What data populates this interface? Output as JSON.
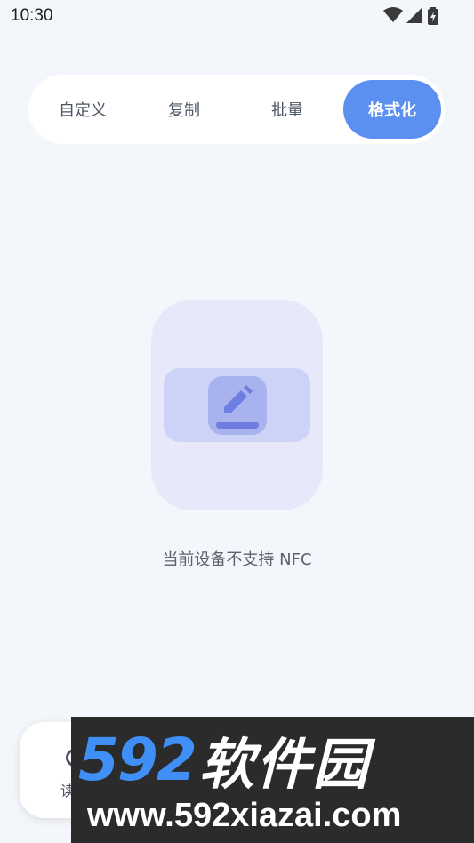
{
  "status_bar": {
    "time": "10:30"
  },
  "tabs": [
    {
      "label": "自定义",
      "active": false
    },
    {
      "label": "复制",
      "active": false
    },
    {
      "label": "批量",
      "active": false
    },
    {
      "label": "格式化",
      "active": true
    }
  ],
  "colors": {
    "accent": "#5b8ff0",
    "background": "#f3f6fa",
    "illustration_outer": "#e7e9fa",
    "illustration_inner": "#cdd3f6",
    "illustration_icon": "#a8b2ee"
  },
  "empty_state": {
    "icon": "edit-icon",
    "message": "当前设备不支持 NFC"
  },
  "fab": {
    "label": "读"
  },
  "watermark": {
    "brand_number": "592",
    "brand_text": "软件园",
    "url": "www.592xiazai.com"
  }
}
